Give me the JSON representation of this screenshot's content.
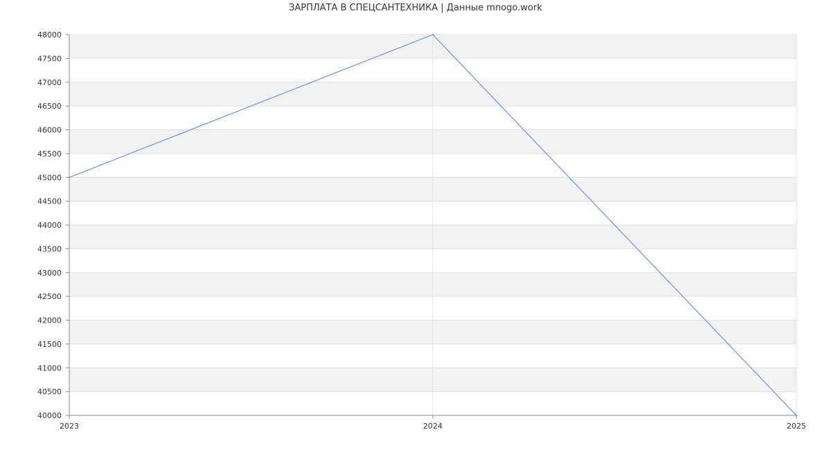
{
  "chart_data": {
    "type": "line",
    "title": "ЗАРПЛАТА В СПЕЦСАНТЕХНИКА | Данные mnogo.work",
    "xlabel": "",
    "ylabel": "",
    "categories": [
      "2023",
      "2024",
      "2025"
    ],
    "series": [
      {
        "values": [
          45000,
          48000,
          40000
        ]
      }
    ],
    "ylim": [
      40000,
      48000
    ],
    "yticks": [
      "40000",
      "40500",
      "41000",
      "41500",
      "42000",
      "42500",
      "43000",
      "43500",
      "44000",
      "44500",
      "45000",
      "45500",
      "46000",
      "46500",
      "47000",
      "47500",
      "48000"
    ],
    "grid": true,
    "legend": "none",
    "colors": {
      "line": "#6f9ae8",
      "band": "#f2f2f2",
      "grid": "#e0e0e0",
      "axis": "#888888",
      "text": "#333333"
    }
  }
}
